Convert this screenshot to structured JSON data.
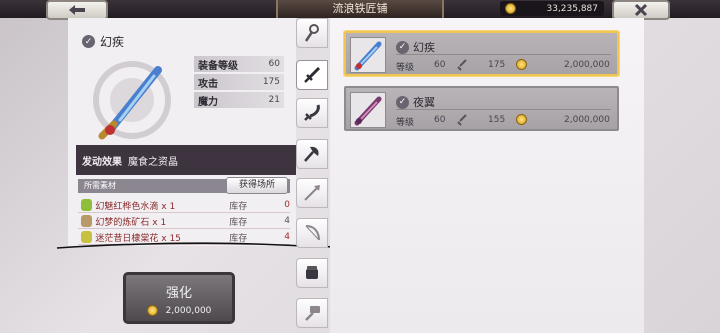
{
  "header": {
    "title": "流浪铁匠铺",
    "gold": "33,235,887"
  },
  "detail": {
    "item_name": "幻疾",
    "stats": [
      {
        "label": "装备等级",
        "value": "60"
      },
      {
        "label": "攻击",
        "value": "175"
      },
      {
        "label": "魔力",
        "value": "21"
      }
    ],
    "effect_key": "发动效果",
    "effect_value": "魔食之资晶",
    "materials_header": "所需素材",
    "source_button": "获得场所",
    "materials": [
      {
        "name": "幻魅红桦色水滴 x 1",
        "stock_label": "库存",
        "stock": "0",
        "icon_color": "#8fbf3a"
      },
      {
        "name": "幻梦的炼矿石 x 1",
        "stock_label": "库存",
        "stock": "4",
        "icon_color": "#b89a6a"
      },
      {
        "name": "迷茫昔日棣棠花 x 15",
        "stock_label": "库存",
        "stock": "4",
        "icon_color": "#c8c040"
      }
    ]
  },
  "enhance": {
    "label": "强化",
    "cost": "2,000,000"
  },
  "tabs": [
    {
      "name": "tab-staff",
      "icon": "staff-icon"
    },
    {
      "name": "tab-sword",
      "icon": "sword-icon"
    },
    {
      "name": "tab-blade",
      "icon": "blade-icon"
    },
    {
      "name": "tab-axe",
      "icon": "axe-icon"
    },
    {
      "name": "tab-spear",
      "icon": "spear-icon"
    },
    {
      "name": "tab-bow",
      "icon": "bow-icon"
    },
    {
      "name": "tab-gauntlet",
      "icon": "gauntlet-icon"
    },
    {
      "name": "tab-hammer",
      "icon": "hammer-icon"
    }
  ],
  "items": [
    {
      "name": "幻疾",
      "level_label": "等级",
      "level": "60",
      "attack": "175",
      "price": "2,000,000"
    },
    {
      "name": "夜翼",
      "level_label": "等级",
      "level": "60",
      "attack": "155",
      "price": "2,000,000"
    }
  ],
  "colors": {
    "selected_border": "#f0c650",
    "effect_bg": "#3e3440"
  }
}
